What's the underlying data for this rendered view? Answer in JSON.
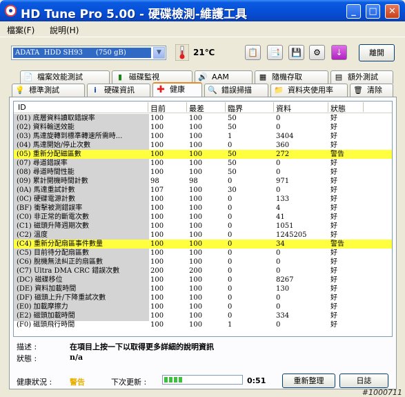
{
  "window": {
    "title": "HD Tune Pro  5.00 - 硬碟檢測-維護工具"
  },
  "menu": [
    "檔案(F)",
    "說明(H)"
  ],
  "toolbar": {
    "drive": "ADATA  HDD SH93      (750 gB)",
    "temperature": "21℃",
    "exit_label": "離開"
  },
  "tabs_top": [
    "檔案效能測試",
    "磁碟監視",
    "AAM",
    "隨機存取",
    "額外測試"
  ],
  "tabs_bottom": [
    "標準測試",
    "硬碟資訊",
    "健康",
    "錯誤掃描",
    "資料夾使用率",
    "清除"
  ],
  "active_tab": "健康",
  "columns": [
    "ID",
    "目前",
    "最差",
    "臨界",
    "資料",
    "狀態"
  ],
  "rows": [
    [
      "(01) 底層資料讀取錯誤率",
      "100",
      "100",
      "50",
      "0",
      "好",
      false
    ],
    [
      "(02) 資料輸送效能",
      "100",
      "100",
      "50",
      "0",
      "好",
      false
    ],
    [
      "(03) 馬達旋轉到標準轉速所需時...",
      "100",
      "100",
      "1",
      "3404",
      "好",
      false
    ],
    [
      "(04) 馬達開始/停止次數",
      "100",
      "100",
      "0",
      "360",
      "好",
      false
    ],
    [
      "(05) 重新分配磁區數",
      "100",
      "100",
      "50",
      "272",
      "警告",
      true
    ],
    [
      "(07) 尋道錯誤率",
      "100",
      "100",
      "50",
      "0",
      "好",
      false
    ],
    [
      "(08) 尋道時間性能",
      "100",
      "100",
      "50",
      "0",
      "好",
      false
    ],
    [
      "(09) 累計開機時間計數",
      "98",
      "98",
      "0",
      "971",
      "好",
      false
    ],
    [
      "(0A) 馬達重試計數",
      "107",
      "100",
      "30",
      "0",
      "好",
      false
    ],
    [
      "(0C) 硬碟電源計數",
      "100",
      "100",
      "0",
      "133",
      "好",
      false
    ],
    [
      "(BF) 衝擊被測錯誤率",
      "100",
      "100",
      "0",
      "4",
      "好",
      false
    ],
    [
      "(C0) 非正常的斷電次數",
      "100",
      "100",
      "0",
      "41",
      "好",
      false
    ],
    [
      "(C1) 磁頭升降週期次數",
      "100",
      "100",
      "0",
      "1051",
      "好",
      false
    ],
    [
      "(C2) 溫度",
      "100",
      "100",
      "0",
      "1245205",
      "好",
      false
    ],
    [
      "(C4) 重新分配扇區事件數量",
      "100",
      "100",
      "0",
      "34",
      "警告",
      true
    ],
    [
      "(C5) 目前待分配扇區數",
      "100",
      "100",
      "0",
      "0",
      "好",
      false
    ],
    [
      "(C6) 脫機無法糾正的扇區數",
      "100",
      "100",
      "0",
      "0",
      "好",
      false
    ],
    [
      "(C7) Ultra DMA CRC 錯誤次數",
      "200",
      "200",
      "0",
      "0",
      "好",
      false
    ],
    [
      "(DC) 磁碟移位",
      "100",
      "100",
      "0",
      "8267",
      "好",
      false
    ],
    [
      "(DE) 資料加載時間",
      "100",
      "100",
      "0",
      "130",
      "好",
      false
    ],
    [
      "(DF) 磁頭上升/下降重試次數",
      "100",
      "100",
      "0",
      "0",
      "好",
      false
    ],
    [
      "(E0) 加載摩擦力",
      "100",
      "100",
      "0",
      "0",
      "好",
      false
    ],
    [
      "(E2) 磁頭加載時間",
      "100",
      "100",
      "0",
      "334",
      "好",
      false
    ],
    [
      "(F0) 磁頭飛行時間",
      "100",
      "100",
      "1",
      "0",
      "好",
      false
    ]
  ],
  "description": {
    "label": "描述 :",
    "text": "在項目上按一下以取得更多詳細的說明資訊"
  },
  "state": {
    "label": "狀態 :",
    "text": "n/a"
  },
  "status": {
    "health_label": "健康狀況 :",
    "health_value": "警告",
    "next_update_label": "下次更新 :",
    "timer": "0:51",
    "progress_fraction": 0.25,
    "refresh_label": "重新整理",
    "log_label": "日誌"
  },
  "watermark": "#1000711",
  "colors": {
    "warning_row": "#ffff40",
    "warning_text": "#e8b000"
  }
}
